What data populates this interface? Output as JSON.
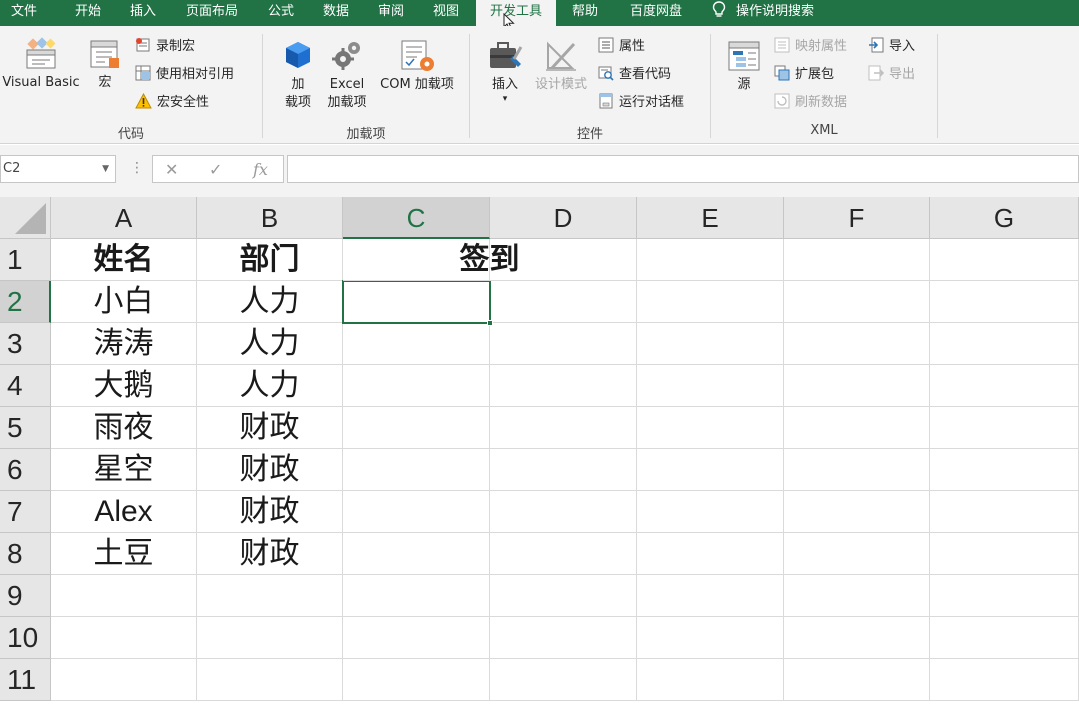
{
  "menu": {
    "tabs": [
      "文件",
      "开始",
      "插入",
      "页面布局",
      "公式",
      "数据",
      "审阅",
      "视图",
      "开发工具",
      "帮助",
      "百度网盘"
    ],
    "active_tab": "开发工具",
    "search_label": "操作说明搜索"
  },
  "ribbon": {
    "code": {
      "label": "代码",
      "visual_basic": "Visual Basic",
      "macros": "宏",
      "record_macro": "录制宏",
      "relative_ref": "使用相对引用",
      "macro_security": "宏安全性"
    },
    "addins": {
      "label": "加载项",
      "addins_line1": "加",
      "addins_line2": "载项",
      "excel_addins_line1": "Excel",
      "excel_addins_line2": "加载项",
      "com_addins": "COM 加载项"
    },
    "controls": {
      "label": "控件",
      "insert": "插入",
      "design_mode": "设计模式",
      "properties": "属性",
      "view_code": "查看代码",
      "run_dialog": "运行对话框"
    },
    "xml": {
      "label": "XML",
      "source": "源",
      "map_properties": "映射属性",
      "expansion_packs": "扩展包",
      "refresh_data": "刷新数据",
      "import": "导入",
      "export": "导出"
    }
  },
  "formula_bar": {
    "name_box": "C2",
    "cancel_symbol": "✕",
    "enter_symbol": "✓",
    "fx_symbol": "fx",
    "formula": ""
  },
  "sheet": {
    "columns": [
      "A",
      "B",
      "C",
      "D",
      "E",
      "F",
      "G"
    ],
    "rows": [
      "1",
      "2",
      "3",
      "4",
      "5",
      "6",
      "7",
      "8",
      "9",
      "10",
      "11"
    ],
    "headers": {
      "name": "姓名",
      "dept": "部门",
      "signin": "签到"
    },
    "records": [
      {
        "name": "小白",
        "dept": "人力"
      },
      {
        "name": "涛涛",
        "dept": "人力"
      },
      {
        "name": "大鹅",
        "dept": "人力"
      },
      {
        "name": "雨夜",
        "dept": "财政"
      },
      {
        "name": "星空",
        "dept": "财政"
      },
      {
        "name": "Alex",
        "dept": "财政"
      },
      {
        "name": "土豆",
        "dept": "财政"
      }
    ],
    "selected_cell": "C2"
  },
  "colors": {
    "accent": "#217346",
    "ribbon_bg": "#f3f3f3",
    "header_bg": "#e6e6e6",
    "gridline": "#dadada"
  }
}
